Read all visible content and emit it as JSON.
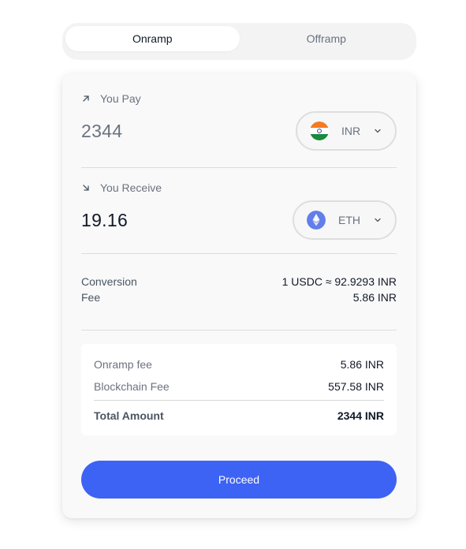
{
  "tabs": [
    {
      "label": "Onramp",
      "active": true
    },
    {
      "label": "Offramp",
      "active": false
    }
  ],
  "pay": {
    "label": "You Pay",
    "amount": "2344",
    "currency": "INR",
    "currency_icon": "india-flag-icon"
  },
  "receive": {
    "label": "You Receive",
    "amount": "19.16",
    "currency": "ETH",
    "currency_icon": "ethereum-icon"
  },
  "summary": {
    "conversion_label": "Conversion",
    "conversion_value": "1 USDC ≈ 92.9293 INR",
    "fee_label": "Fee",
    "fee_value": "5.86 INR"
  },
  "fees": {
    "onramp_label": "Onramp fee",
    "onramp_value": "5.86 INR",
    "blockchain_label": "Blockchain Fee",
    "blockchain_value": "557.58 INR",
    "total_label": "Total Amount",
    "total_value": "2344 INR"
  },
  "proceed_label": "Proceed",
  "colors": {
    "accent": "#3d63f5",
    "card_bg": "#f9f9f9",
    "muted_text": "#6b7280"
  }
}
